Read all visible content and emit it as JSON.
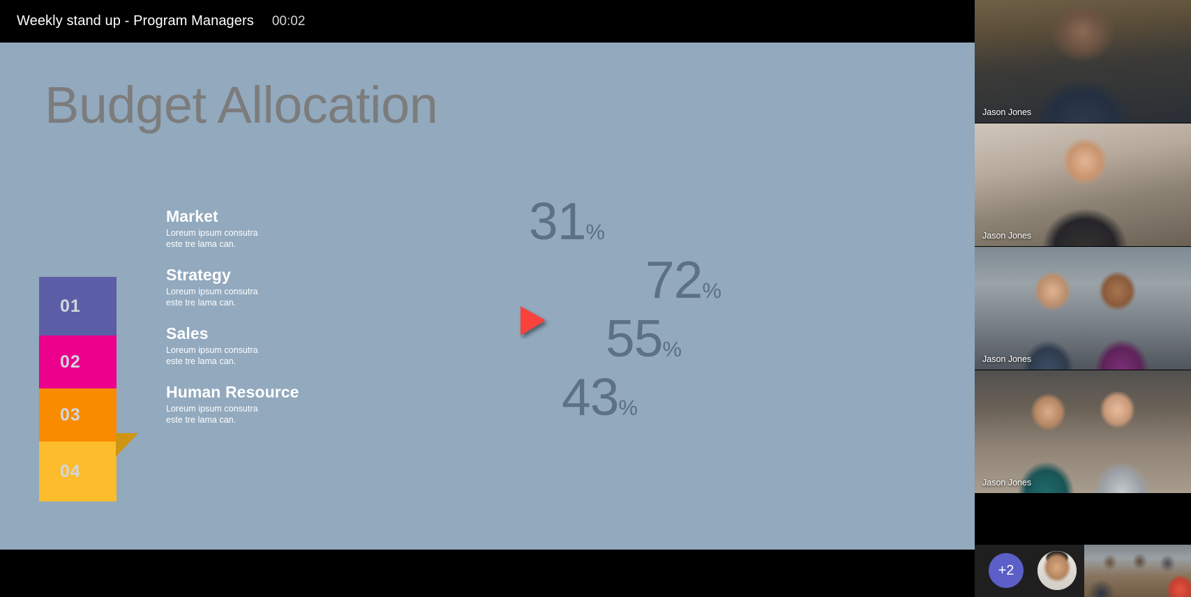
{
  "meeting": {
    "title": "Weekly stand up - Program Managers",
    "timer": "00:02"
  },
  "slide": {
    "title": "Budget Allocation",
    "background_color": "#92a9be",
    "title_color": "#7c7c7c",
    "percent_color": "#5c7183",
    "items": [
      {
        "number": "01",
        "title": "Market",
        "description_line1": "Loreum ipsum consutra",
        "description_line2": "este tre lama can.",
        "percent": "31",
        "percent_symbol": "%",
        "color": "#5b5ea6"
      },
      {
        "number": "02",
        "title": "Strategy",
        "description_line1": "Loreum ipsum consutra",
        "description_line2": "este tre lama can.",
        "percent": "72",
        "percent_symbol": "%",
        "color": "#ec008c"
      },
      {
        "number": "03",
        "title": "Sales",
        "description_line1": "Loreum ipsum consutra",
        "description_line2": "este tre lama can.",
        "percent": "55",
        "percent_symbol": "%",
        "color": "#f98b00"
      },
      {
        "number": "04",
        "title": "Human Resource",
        "description_line1": "Loreum ipsum consutra",
        "description_line2": "este tre lama can.",
        "percent": "43",
        "percent_symbol": "%",
        "color": "#fcbc2b"
      }
    ],
    "fold_color": "#cf9512",
    "pointer_color": "#f9423a"
  },
  "chart_data": {
    "type": "bar",
    "title": "Budget Allocation",
    "orientation": "horizontal",
    "categories": [
      "Market",
      "Strategy",
      "Sales",
      "Human Resource"
    ],
    "values": [
      31,
      72,
      55,
      43
    ],
    "value_unit": "%",
    "labels": [
      "01",
      "02",
      "03",
      "04"
    ],
    "colors": [
      "#5b5ea6",
      "#ec008c",
      "#f98b00",
      "#fcbc2b"
    ],
    "xlabel": "",
    "ylabel": "",
    "xlim": [
      0,
      100
    ],
    "grid": false,
    "legend": "none"
  },
  "rail": {
    "tiles": [
      {
        "name": "Jason Jones",
        "scene": "bearded-man-in-warehouse"
      },
      {
        "name": "Jason Jones",
        "scene": "man-in-apron-in-cafe"
      },
      {
        "name": "Jason Jones",
        "scene": "two-colleagues-with-tablet"
      },
      {
        "name": "Jason Jones",
        "scene": "two-women-at-laptop"
      }
    ],
    "strip": {
      "overflow_badge": "+2",
      "self_video": "self-avatar",
      "extra_tile": "conference-room"
    }
  }
}
